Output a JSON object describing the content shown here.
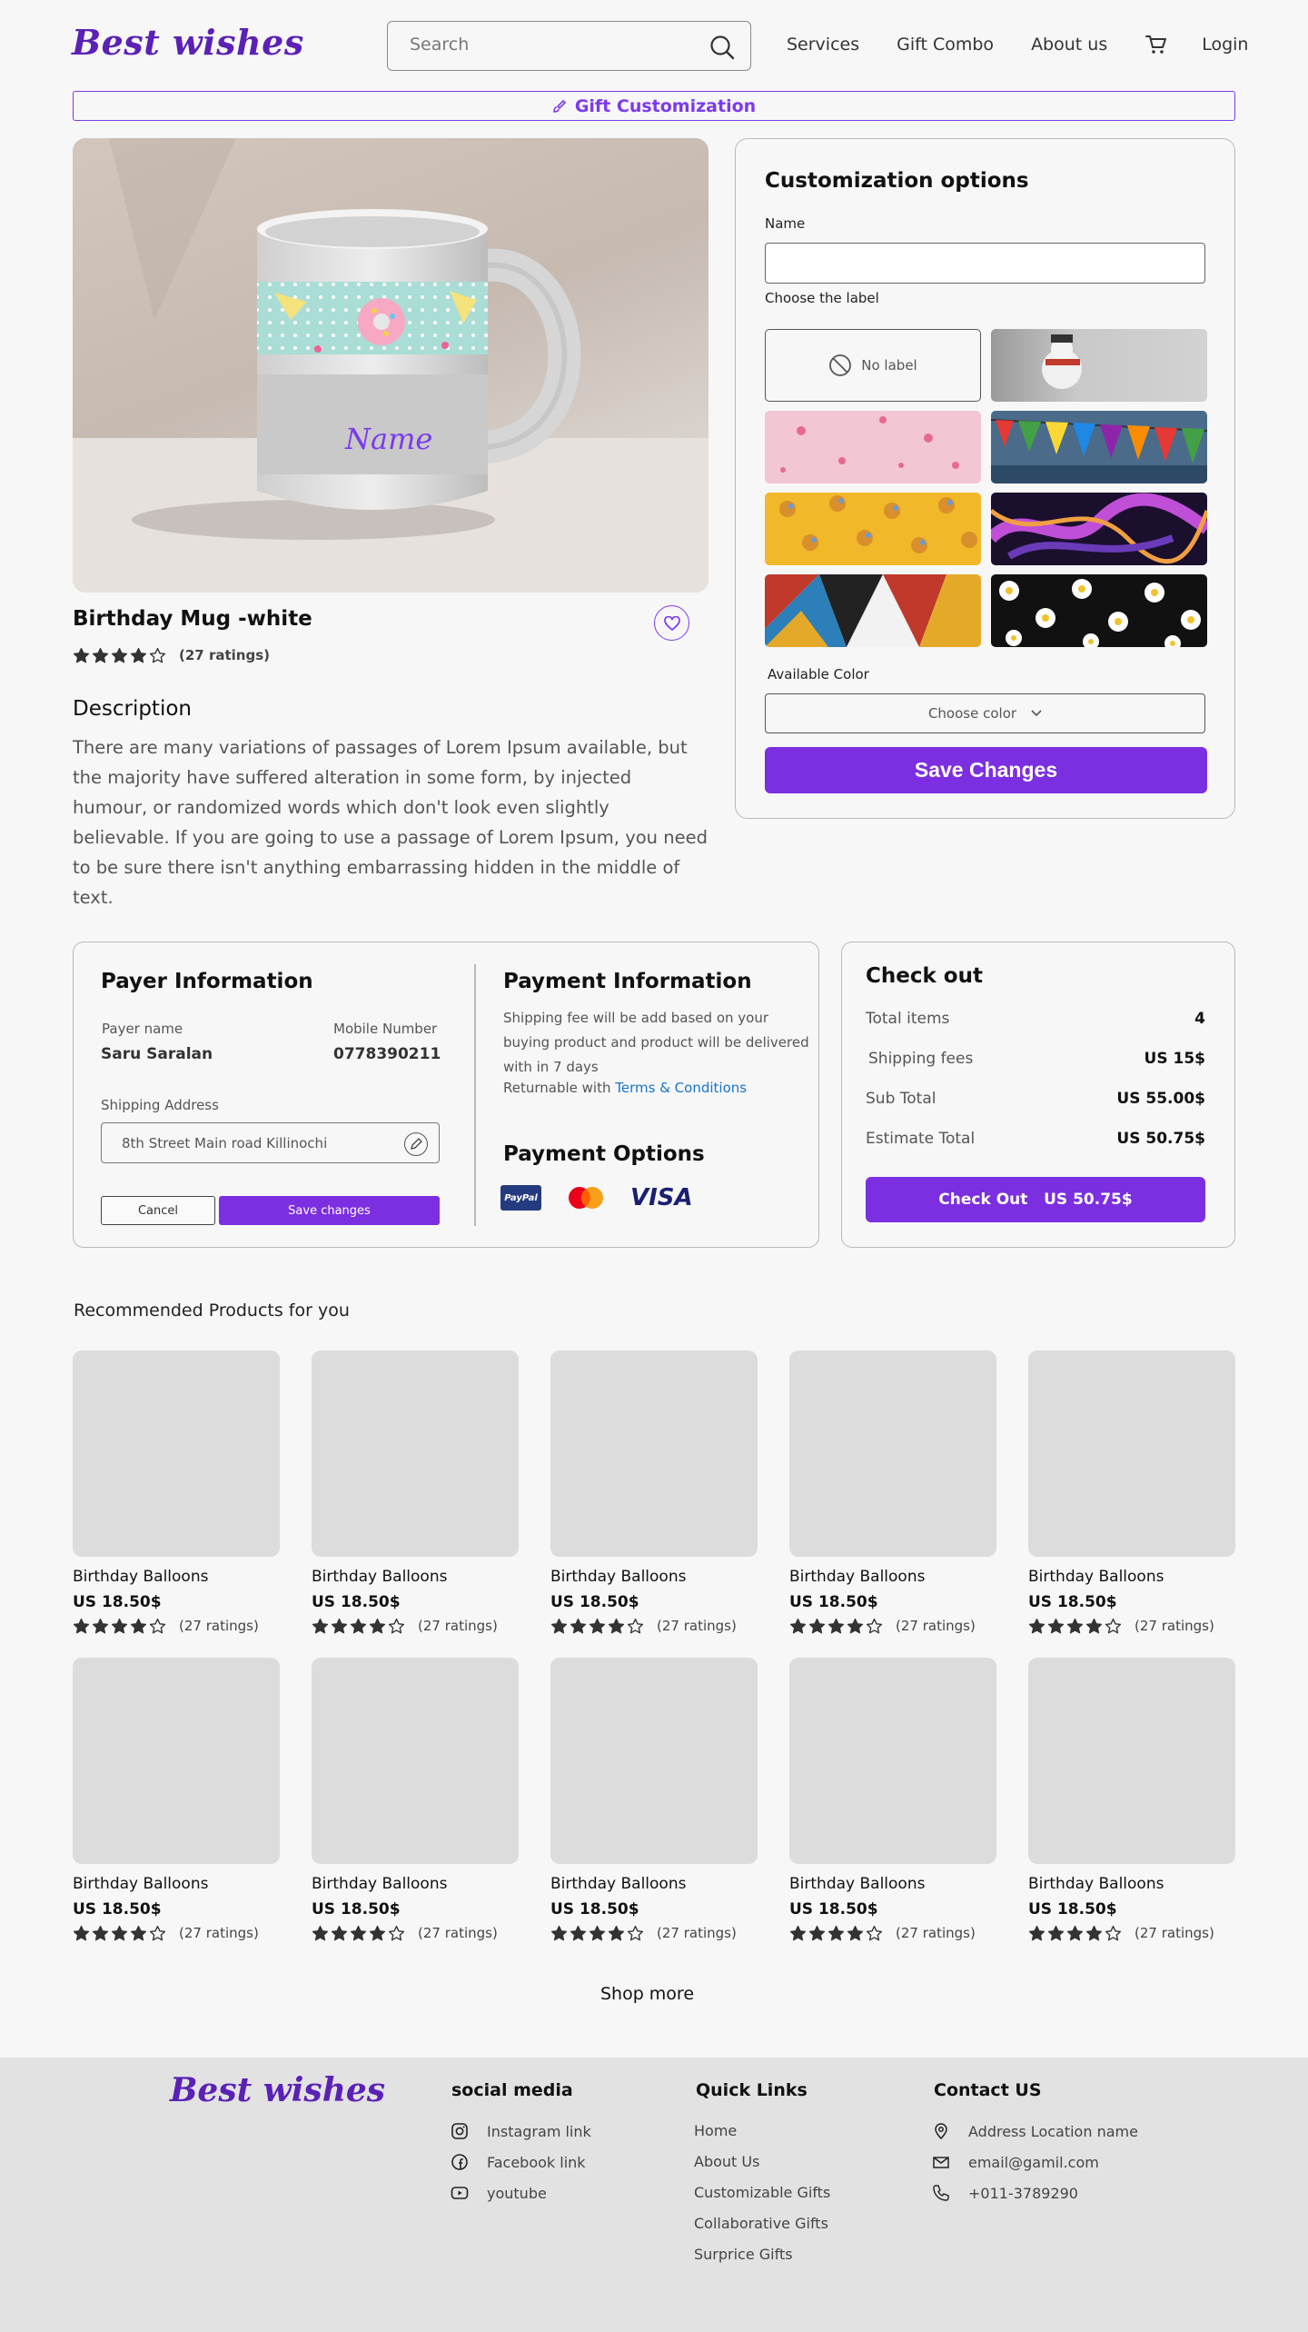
{
  "header": {
    "logo": "Best wishes",
    "search_placeholder": "Search",
    "nav": [
      "Services",
      "Gift Combo",
      "About us"
    ],
    "login": "Login"
  },
  "banner": {
    "label": "Gift Customization"
  },
  "product": {
    "mug_text": "Name",
    "title": "Birthday  Mug -white",
    "rating": 4,
    "rating_text": "(27 ratings)",
    "description_title": "Description",
    "description": "There are many variations of passages of Lorem Ipsum available, but the majority have suffered alteration in some form, by injected humour, or randomized words which don't look even slightly believable. If you are going to use a passage of Lorem Ipsum, you need to be sure there isn't anything embarrassing hidden in the middle of text."
  },
  "customization": {
    "title": "Customization options",
    "name_label": "Name",
    "name_value": "",
    "label_label": "Choose the label",
    "no_label": "No label",
    "labels": [
      "snowman",
      "hearts",
      "bunting-flags",
      "ducks",
      "fluid-art",
      "geometric",
      "daisies"
    ],
    "color_label": "Available Color",
    "color_placeholder": "Choose color",
    "save": "Save Changes"
  },
  "payer": {
    "title": "Payer Information",
    "name_label": "Payer name",
    "name": "Saru Saralan",
    "mobile_label": "Mobile Number",
    "mobile": "0778390211",
    "address_label": "Shipping Address",
    "address": "8th Street Main road Killinochi",
    "cancel": "Cancel",
    "save": "Save changes"
  },
  "payment": {
    "title": "Payment Information",
    "text": "Shipping fee will be add based on your buying product and product will be delivered with in 7 days",
    "returnable": "Returnable with",
    "terms": "Terms & Conditions",
    "options_title": "Payment Options",
    "paypal": "PayPal",
    "visa": "VISA"
  },
  "checkout": {
    "title": "Check out",
    "rows": [
      {
        "k": "Total items",
        "v": "4"
      },
      {
        "k": "Shipping fees",
        "v": "US 15$"
      },
      {
        "k": "Sub Total",
        "v": "US 55.00$"
      },
      {
        "k": "Estimate Total",
        "v": "US 50.75$"
      }
    ],
    "button": "Check Out   US 50.75$"
  },
  "recommended": {
    "title": "Recommended Products for you",
    "products": [
      {
        "name": "Birthday Balloons",
        "price": "US 18.50$",
        "rating": 4,
        "rating_text": "(27 ratings)"
      },
      {
        "name": "Birthday Balloons",
        "price": "US 18.50$",
        "rating": 4,
        "rating_text": "(27 ratings)"
      },
      {
        "name": "Birthday Balloons",
        "price": "US 18.50$",
        "rating": 4,
        "rating_text": "(27 ratings)"
      },
      {
        "name": "Birthday Balloons",
        "price": "US 18.50$",
        "rating": 4,
        "rating_text": "(27 ratings)"
      },
      {
        "name": "Birthday Balloons",
        "price": "US 18.50$",
        "rating": 4,
        "rating_text": "(27 ratings)"
      },
      {
        "name": "Birthday Balloons",
        "price": "US 18.50$",
        "rating": 4,
        "rating_text": "(27 ratings)"
      },
      {
        "name": "Birthday Balloons",
        "price": "US 18.50$",
        "rating": 4,
        "rating_text": "(27 ratings)"
      },
      {
        "name": "Birthday Balloons",
        "price": "US 18.50$",
        "rating": 4,
        "rating_text": "(27 ratings)"
      },
      {
        "name": "Birthday Balloons",
        "price": "US 18.50$",
        "rating": 4,
        "rating_text": "(27 ratings)"
      },
      {
        "name": "Birthday Balloons",
        "price": "US 18.50$",
        "rating": 4,
        "rating_text": "(27 ratings)"
      }
    ],
    "shop_more": "Shop more"
  },
  "footer": {
    "logo": "Best wishes",
    "social_title": "social media",
    "social": [
      "Instagram link",
      "Facebook link",
      "youtube"
    ],
    "quick_title": "Quick Links",
    "quick": [
      "Home",
      "About Us",
      "Customizable Gifts",
      "Collaborative Gifts",
      "Surprice Gifts"
    ],
    "contact_title": "Contact US",
    "contact": [
      "Address Location name",
      "email@gamil.com",
      "+011-3789290"
    ]
  },
  "colors": {
    "accent": "#7c2fe0",
    "logo": "#5b21b6",
    "footer_bg": "#e2e2e2"
  }
}
